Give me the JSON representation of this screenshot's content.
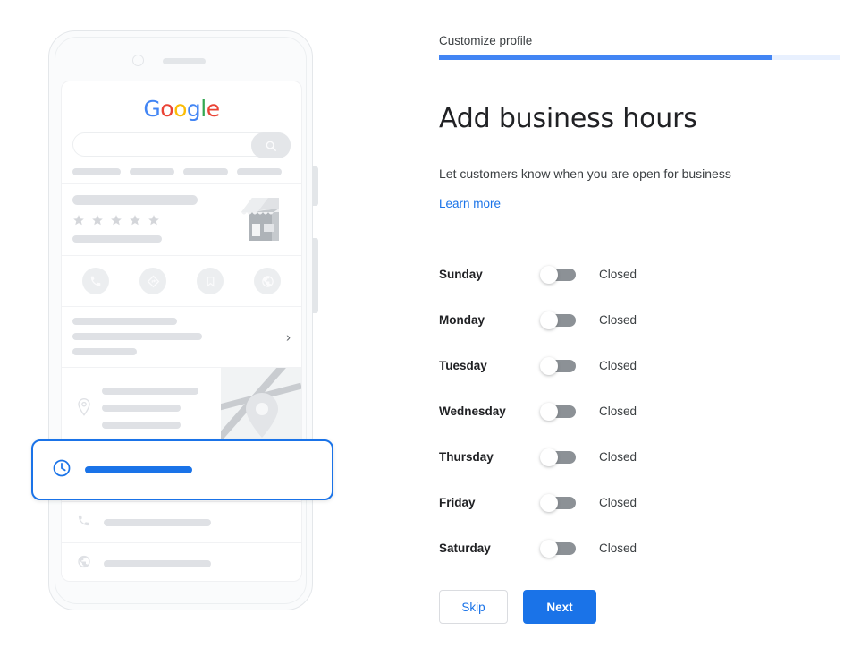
{
  "breadcrumb": {
    "label": "Customize profile"
  },
  "progress": {
    "percent": 83,
    "fill_color": "#4285f4",
    "track_color": "#e8f0fe"
  },
  "heading": {
    "title": "Add business hours"
  },
  "description": {
    "text": "Let customers know when you are open for business"
  },
  "learn_more": {
    "label": "Learn more",
    "color": "#1a73e8"
  },
  "hours": {
    "days": [
      {
        "name": "Sunday",
        "state": "Closed",
        "enabled": false
      },
      {
        "name": "Monday",
        "state": "Closed",
        "enabled": false
      },
      {
        "name": "Tuesday",
        "state": "Closed",
        "enabled": false
      },
      {
        "name": "Wednesday",
        "state": "Closed",
        "enabled": false
      },
      {
        "name": "Thursday",
        "state": "Closed",
        "enabled": false
      },
      {
        "name": "Friday",
        "state": "Closed",
        "enabled": false
      },
      {
        "name": "Saturday",
        "state": "Closed",
        "enabled": false
      }
    ]
  },
  "actions": {
    "skip_label": "Skip",
    "next_label": "Next",
    "next_bg": "#1a73e8",
    "skip_text_color": "#1a73e8"
  },
  "phone_preview": {
    "logo": {
      "letters": [
        "G",
        "o",
        "o",
        "g",
        "l",
        "e"
      ],
      "colors": [
        "#4285f4",
        "#ea4335",
        "#fbbc05",
        "#4285f4",
        "#34a853",
        "#ea4335"
      ]
    },
    "search_icon": "search-icon",
    "nav_placeholder_count": 4,
    "rating_stars": 5,
    "action_icons": [
      "phone-icon",
      "directions-icon",
      "bookmark-icon",
      "globe-icon"
    ],
    "highlight_card": {
      "icon": "clock-icon",
      "border_color": "#1a73e8",
      "bar_color": "#1a73e8"
    },
    "row_icons": [
      "location-pin-icon",
      "clock-icon",
      "phone-icon",
      "globe-icon"
    ],
    "placeholder_color": "#dfe1e5"
  }
}
